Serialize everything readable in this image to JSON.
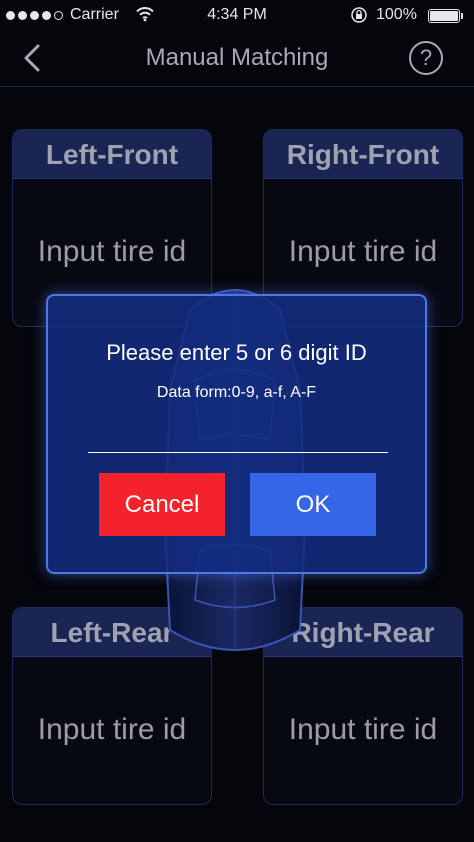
{
  "status_bar": {
    "carrier": "Carrier",
    "time": "4:34 PM",
    "battery": "100%",
    "battery_level": 1.0,
    "signal_bars": 4,
    "signal_total": 5
  },
  "nav": {
    "title": "Manual Matching",
    "help_label": "?"
  },
  "tires": {
    "left_front": {
      "label": "Left-Front",
      "placeholder": "Input tire id"
    },
    "right_front": {
      "label": "Right-Front",
      "placeholder": "Input tire id"
    },
    "left_rear": {
      "label": "Left-Rear",
      "placeholder": "Input tire id"
    },
    "right_rear": {
      "label": "Right-Rear",
      "placeholder": "Input tire id"
    }
  },
  "dialog": {
    "title": "Please enter 5 or 6 digit ID",
    "subtitle": "Data form:0-9, a-f, A-F",
    "input_value": "",
    "cancel_label": "Cancel",
    "ok_label": "OK"
  },
  "colors": {
    "background": "#05060c",
    "card_header": "#1b2554",
    "dialog_bg": "#142d82",
    "dialog_border": "#4d78e6",
    "cancel": "#f4222a",
    "ok": "#3566e6"
  },
  "icons": {
    "back": "chevron-left-icon",
    "help": "help-circle-icon",
    "wifi": "wifi-icon",
    "lock": "orientation-lock-icon"
  }
}
